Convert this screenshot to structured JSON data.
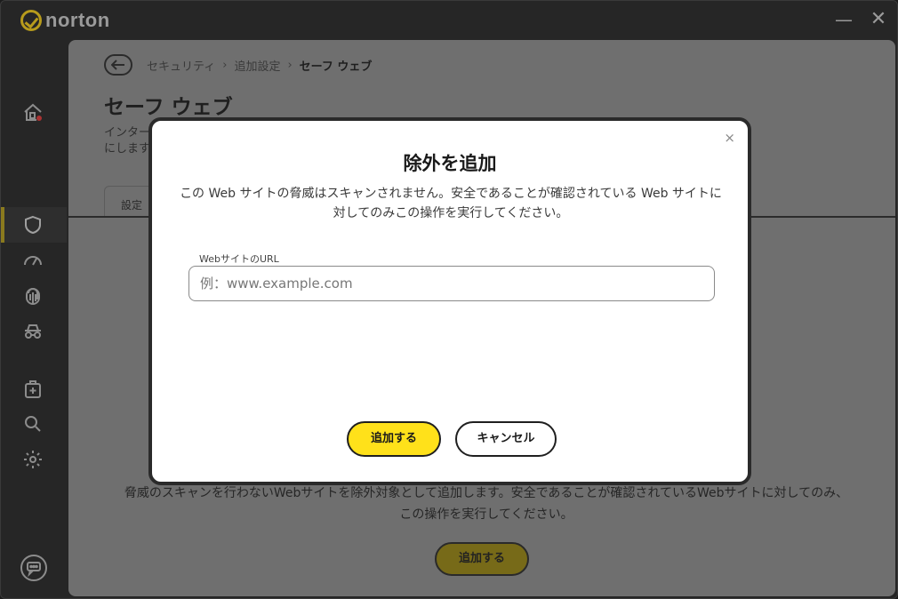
{
  "app": {
    "name": "norton",
    "accent": "#ffe11a"
  },
  "titlebar": {
    "minimize": "—",
    "close": "✕"
  },
  "sidebar": {
    "icons": [
      "home-alert-icon",
      "shield-icon",
      "speedometer-icon",
      "fingerprint-icon",
      "incognito-icon",
      "medical-bag-icon",
      "search-icon",
      "gear-icon",
      "chat-icon"
    ],
    "active": "shield-icon"
  },
  "breadcrumb": {
    "items": [
      "セキュリティ",
      "追加設定"
    ],
    "current": "セーフ ウェブ",
    "separator": "›"
  },
  "page": {
    "title": "セーフ ウェブ",
    "description_line1": "インター",
    "description_line2": "にします",
    "tab": "設定",
    "empty_text": "脅威のスキャンを行わないWebサイトを除外対象として追加します。安全であることが確認されているWebサイトに対してのみ、この操作を実行してください。",
    "add_button": "追加する"
  },
  "modal": {
    "close": "×",
    "title": "除外を追加",
    "description": "この Web サイトの脅威はスキャンされません。安全であることが確認されている Web サイトに対してのみこの操作を実行してください。",
    "url_label": "WebサイトのURL",
    "url_value": "",
    "url_placeholder": "例：www.example.com",
    "add_button": "追加する",
    "cancel_button": "キャンセル"
  }
}
